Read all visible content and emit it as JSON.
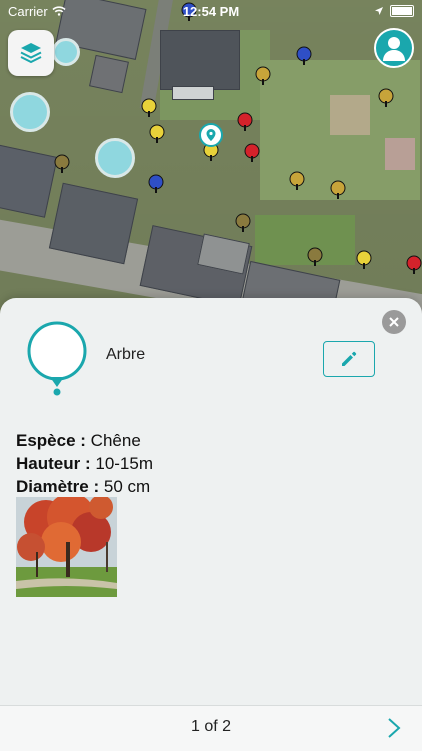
{
  "status_bar": {
    "carrier": "Carrier",
    "time": "12:54 PM"
  },
  "map": {
    "tree_colors": [
      "#e8d23a",
      "#d4222b",
      "#2f4fc6",
      "#c7a43a",
      "#8a7a3e"
    ]
  },
  "feature": {
    "type": "Arbre",
    "properties": [
      {
        "key": "Espèce :",
        "value": "Chêne"
      },
      {
        "key": "Hauteur :",
        "value": "10-15m"
      },
      {
        "key": "Diamètre :",
        "value": "50 cm"
      }
    ]
  },
  "pager": {
    "label": "1 of 2"
  },
  "colors": {
    "accent": "#1aa7ad"
  }
}
